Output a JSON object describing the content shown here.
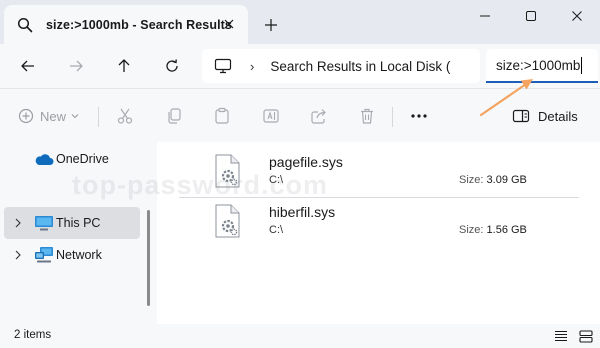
{
  "window": {
    "tab_title": "size:>1000mb - Search Results",
    "new_tab_symbol": "+"
  },
  "address_bar": {
    "separator": "›",
    "path_text": "Search Results in Local Disk ("
  },
  "search": {
    "value": "size:>1000mb"
  },
  "toolbar": {
    "new_label": "New",
    "more_symbol": "···",
    "details_label": "Details"
  },
  "sidebar": {
    "items": [
      {
        "label": "OneDrive",
        "icon": "cloud-icon",
        "has_chevron": false
      },
      {
        "label": "This PC",
        "icon": "monitor-icon",
        "has_chevron": true
      },
      {
        "label": "Network",
        "icon": "network-icon",
        "has_chevron": true
      }
    ]
  },
  "files": [
    {
      "name": "pagefile.sys",
      "path": "C:\\",
      "size_label": "Size:",
      "size": "3.09 GB"
    },
    {
      "name": "hiberfil.sys",
      "path": "C:\\",
      "size_label": "Size:",
      "size": "1.56 GB"
    }
  ],
  "watermark": "top-password.com",
  "status": {
    "count": "2 items"
  },
  "colors": {
    "accent": "#1d5fb8",
    "annotation_arrow": "#f4a460",
    "onedrive": "#0f6cbd"
  }
}
